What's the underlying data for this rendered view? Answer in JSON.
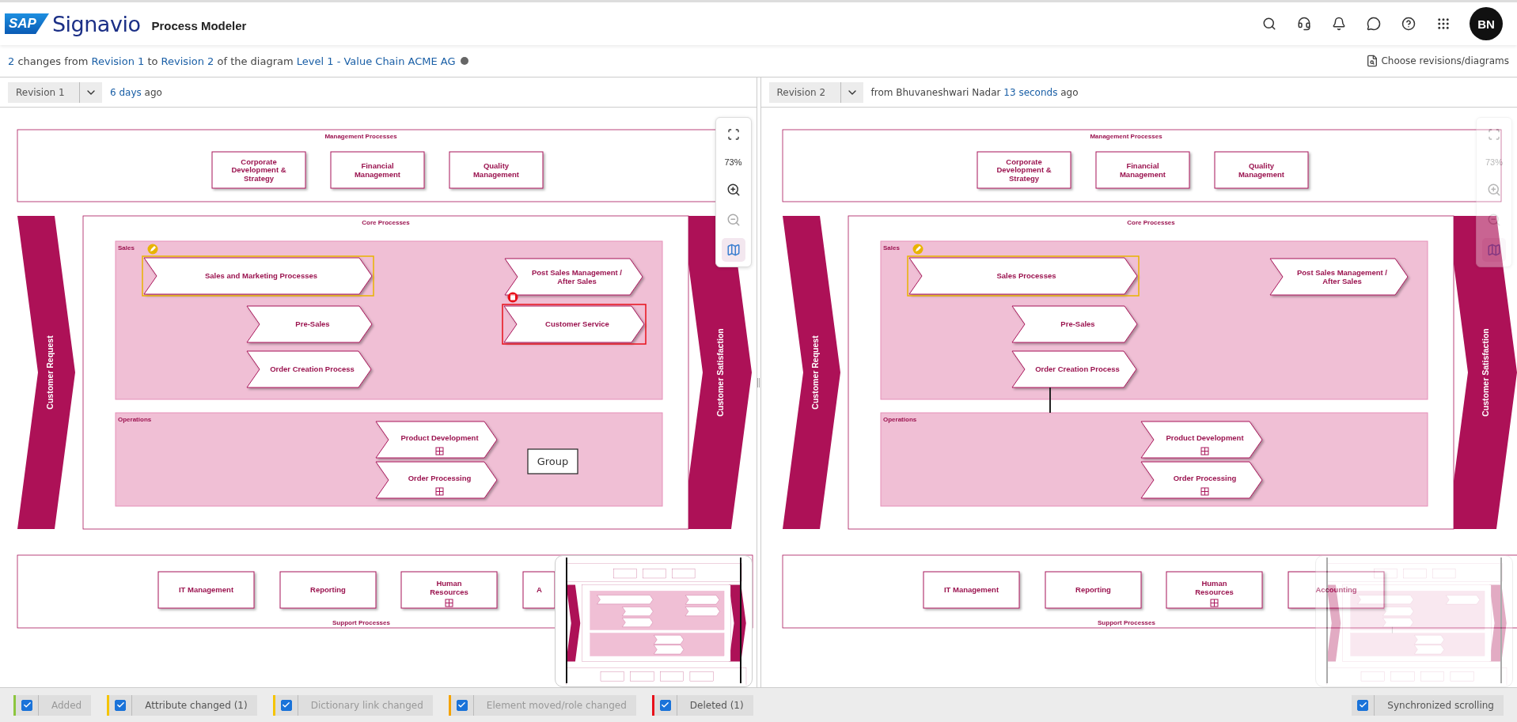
{
  "header": {
    "logo": "SAP",
    "brand": "Signavio",
    "app": "Process Modeler",
    "avatar": "BN"
  },
  "summary": [
    {
      "text": "2",
      "link": true
    },
    {
      "text": " changes from ",
      "link": false
    },
    {
      "text": "Revision 1",
      "link": true
    },
    {
      "text": " to ",
      "link": false
    },
    {
      "text": "Revision 2",
      "link": true
    },
    {
      "text": " of the diagram ",
      "link": false
    },
    {
      "text": "Level 1 - Value Chain ACME AG",
      "link": true
    }
  ],
  "choose_link": "Choose revisions/diagrams",
  "panes": [
    {
      "revision": "Revision 1",
      "meta": [
        {
          "text": "6 days",
          "link": true
        },
        {
          "text": " ago",
          "link": false
        }
      ],
      "zoom": {
        "label": "73%",
        "disabled": false
      },
      "minimap": {
        "translucent": false
      },
      "diagram": {
        "management": {
          "title": "Management Processes",
          "tasks": [
            {
              "label": "Corporate\nDevelopment &\nStrategy"
            },
            {
              "label": "Financial\nManagement"
            },
            {
              "label": "Quality\nManagement"
            }
          ]
        },
        "value_chain": [
          "Customer Request",
          "Customer Satisfaction"
        ],
        "core": {
          "title": "Core Processes",
          "lanes": [
            {
              "title": "Sales",
              "items": [
                {
                  "label": "Sales and Marketing Processes",
                  "attribute_changed": true,
                  "deleted": false,
                  "expandable": false
                },
                {
                  "label": "Post Sales Management /\nAfter Sales",
                  "attribute_changed": false,
                  "deleted": false,
                  "expandable": false
                },
                {
                  "label": "Pre-Sales",
                  "attribute_changed": false,
                  "deleted": false,
                  "expandable": false
                },
                {
                  "label": "Customer Service",
                  "attribute_changed": false,
                  "deleted": true,
                  "expandable": false
                },
                {
                  "label": "Order Creation Process",
                  "attribute_changed": false,
                  "deleted": false,
                  "expandable": false
                }
              ]
            },
            {
              "title": "Operations",
              "items": [
                {
                  "label": "Product Development",
                  "attribute_changed": false,
                  "deleted": false,
                  "expandable": true
                },
                {
                  "label": "Order Processing",
                  "attribute_changed": false,
                  "deleted": false,
                  "expandable": true
                }
              ]
            }
          ]
        },
        "support": {
          "title": "Support Processes",
          "tasks": [
            {
              "label": "IT Management",
              "expandable": false,
              "cut": false
            },
            {
              "label": "Reporting",
              "expandable": false,
              "cut": false
            },
            {
              "label": "Human\nResources",
              "expandable": true,
              "cut": false
            },
            {
              "label": "A",
              "expandable": false,
              "cut": true
            }
          ]
        },
        "group_label": "Group"
      }
    },
    {
      "revision": "Revision 2",
      "meta": [
        {
          "text": "from Bhuvaneshwari Nadar ",
          "link": false
        },
        {
          "text": "13 seconds",
          "link": true
        },
        {
          "text": " ago",
          "link": false
        }
      ],
      "zoom": {
        "label": "73%",
        "disabled": true
      },
      "minimap": {
        "translucent": true
      },
      "diagram": {
        "management": {
          "title": "Management Processes",
          "tasks": [
            {
              "label": "Corporate\nDevelopment &\nStrategy"
            },
            {
              "label": "Financial\nManagement"
            },
            {
              "label": "Quality\nManagement"
            }
          ]
        },
        "value_chain": [
          "Customer Request",
          "Customer Satisfaction"
        ],
        "core": {
          "title": "Core Processes",
          "lanes": [
            {
              "title": "Sales",
              "items": [
                {
                  "label": "Sales Processes",
                  "attribute_changed": true,
                  "deleted": false,
                  "expandable": false
                },
                {
                  "label": "Post Sales Management /\nAfter Sales",
                  "attribute_changed": false,
                  "deleted": false,
                  "expandable": false
                },
                {
                  "label": "Pre-Sales",
                  "attribute_changed": false,
                  "deleted": false,
                  "expandable": false
                },
                {
                  "label": "Order Creation Process",
                  "attribute_changed": false,
                  "deleted": false,
                  "expandable": false
                }
              ]
            },
            {
              "title": "Operations",
              "items": [
                {
                  "label": "Product Development",
                  "attribute_changed": false,
                  "deleted": false,
                  "expandable": true
                },
                {
                  "label": "Order Processing",
                  "attribute_changed": false,
                  "deleted": false,
                  "expandable": true
                }
              ]
            }
          ]
        },
        "support": {
          "title": "Support Processes",
          "tasks": [
            {
              "label": "IT Management",
              "expandable": false,
              "cut": false
            },
            {
              "label": "Reporting",
              "expandable": false,
              "cut": false
            },
            {
              "label": "Human\nResources",
              "expandable": true,
              "cut": false
            },
            {
              "label": "Accounting",
              "expandable": false,
              "cut": false
            }
          ]
        },
        "connector": true
      }
    }
  ],
  "legend": [
    {
      "label": "Added",
      "color": "#8cc63f",
      "checked": true,
      "disabled": true
    },
    {
      "label": "Attribute changed (1)",
      "color": "#f5c400",
      "checked": true,
      "disabled": false
    },
    {
      "label": "Dictionary link changed",
      "color": "#f5c400",
      "checked": true,
      "disabled": true
    },
    {
      "label": "Element moved/role changed",
      "color": "#f5a300",
      "checked": true,
      "disabled": true
    },
    {
      "label": "Deleted (1)",
      "color": "#e8101a",
      "checked": true,
      "disabled": false
    }
  ],
  "sync": {
    "label": "Synchronized scrolling",
    "checked": true
  }
}
